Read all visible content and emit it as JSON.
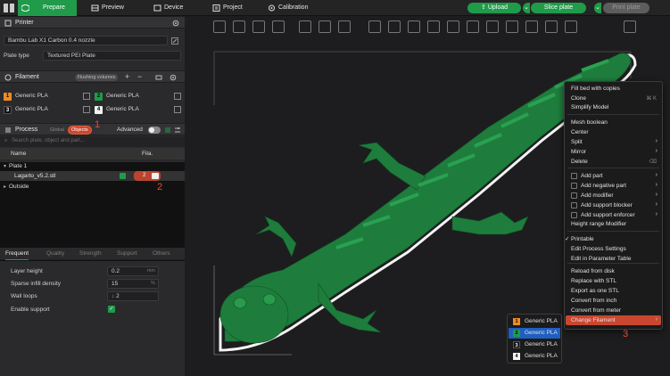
{
  "topbar": {
    "tabs": [
      {
        "label": "Prepare",
        "icon": "cube-icon",
        "active": true
      },
      {
        "label": "Preview",
        "icon": "preview-icon"
      },
      {
        "label": "Device",
        "icon": "device-icon"
      },
      {
        "label": "Project",
        "icon": "project-icon"
      },
      {
        "label": "Calibration",
        "icon": "calibration-icon"
      }
    ],
    "upload_label": "Upload",
    "slice_label": "Slice plate",
    "print_label": "Print plate",
    "accent": "#1f9b4a"
  },
  "printer": {
    "title": "Printer",
    "name": "Bambu Lab X1 Carbon 0.4 nozzle",
    "plate_label": "Plate type",
    "plate_value": "Textured PEI Plate"
  },
  "filament": {
    "title": "Filament",
    "flushing_label": "Flushing volumes",
    "items": [
      {
        "num": "1",
        "name": "Generic PLA",
        "color": "#f08a24",
        "text": "#000"
      },
      {
        "num": "2",
        "name": "Generic PLA",
        "color": "#1f9b4a",
        "text": "#000"
      },
      {
        "num": "3",
        "name": "Generic PLA",
        "color": "#111111",
        "text": "#fff"
      },
      {
        "num": "4",
        "name": "Generic PLA",
        "color": "#f2f2f2",
        "text": "#000"
      }
    ]
  },
  "process": {
    "title": "Process",
    "global_label": "Global",
    "objects_label": "Objects",
    "advanced_label": "Advanced",
    "search_placeholder": "Search plate, object and part..."
  },
  "object_list": {
    "col_name": "Name",
    "col_fila": "Fila.",
    "plate": "Plate 1",
    "object": "Lagarto_v5.2.stl",
    "object_fila": "2",
    "outside": "Outside"
  },
  "params": {
    "tabs": [
      "Frequent",
      "Quality",
      "Strength",
      "Support",
      "Others"
    ],
    "rows": [
      {
        "label": "Layer height",
        "value": "0.2",
        "unit": "mm"
      },
      {
        "label": "Sparse infill density",
        "value": "15",
        "unit": "%"
      },
      {
        "label": "Wall loops",
        "value": "2",
        "unit": ""
      },
      {
        "label": "Enable support",
        "value": "",
        "unit": ""
      }
    ]
  },
  "annotations": {
    "one": "1",
    "two": "2",
    "three": "3"
  },
  "context_menu": {
    "items": [
      {
        "label": "Fill bed with copies"
      },
      {
        "label": "Clone"
      },
      {
        "label": "Simplify Model"
      },
      {
        "label": "Mesh boolean"
      },
      {
        "label": "Center"
      },
      {
        "label": "Split",
        "arrow": true
      },
      {
        "label": "Mirror",
        "arrow": true
      },
      {
        "label": "Delete",
        "shortcut": "⌫"
      },
      {
        "label": "Add part",
        "arrow": true
      },
      {
        "label": "Add negative part",
        "arrow": true
      },
      {
        "label": "Add modifier",
        "arrow": true
      },
      {
        "label": "Add support blocker",
        "arrow": true
      },
      {
        "label": "Add support enforcer",
        "arrow": true
      },
      {
        "label": "Height range Modifier"
      },
      {
        "label": "Printable",
        "check": true
      },
      {
        "label": "Edit Process Settings"
      },
      {
        "label": "Edit in Parameter Table"
      },
      {
        "label": "Reload from disk"
      },
      {
        "label": "Replace with STL"
      },
      {
        "label": "Export as one STL"
      },
      {
        "label": "Convert from inch"
      },
      {
        "label": "Convert from meter"
      },
      {
        "label": "Change Filament",
        "arrow": true,
        "highlight": true
      }
    ],
    "clone_shortcut": "⌘ K"
  },
  "submenu": {
    "items": [
      {
        "num": "1",
        "name": "Generic PLA",
        "color": "#f08a24",
        "text": "#000"
      },
      {
        "num": "2",
        "name": "Generic PLA",
        "color": "#1f9b4a",
        "text": "#000",
        "selected": true
      },
      {
        "num": "3",
        "name": "Generic PLA",
        "color": "#111111",
        "text": "#fff"
      },
      {
        "num": "4",
        "name": "Generic PLA",
        "color": "#f2f2f2",
        "text": "#000"
      }
    ]
  },
  "model_color": "#1e7d3c"
}
